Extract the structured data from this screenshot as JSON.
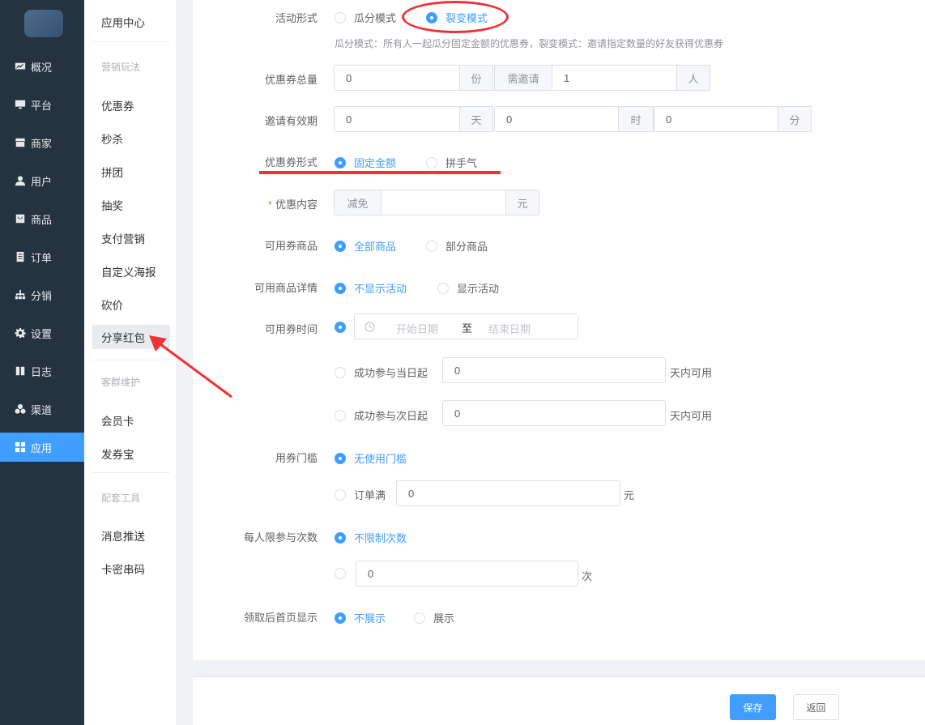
{
  "nav": {
    "items": [
      {
        "label": "概况",
        "icon": "dashboard-icon"
      },
      {
        "label": "平台",
        "icon": "monitor-icon"
      },
      {
        "label": "商家",
        "icon": "store-icon"
      },
      {
        "label": "用户",
        "icon": "user-icon"
      },
      {
        "label": "商品",
        "icon": "goods-icon"
      },
      {
        "label": "订单",
        "icon": "order-icon"
      },
      {
        "label": "分销",
        "icon": "distribution-icon"
      },
      {
        "label": "设置",
        "icon": "gear-icon"
      },
      {
        "label": "日志",
        "icon": "log-icon"
      },
      {
        "label": "渠道",
        "icon": "channel-icon"
      },
      {
        "label": "应用",
        "icon": "apps-icon"
      }
    ],
    "active": "应用"
  },
  "subnav": {
    "title": "应用中心",
    "group_marketing": "营销玩法",
    "items_marketing": [
      "优惠券",
      "秒杀",
      "拼团",
      "抽奖",
      "支付营销",
      "自定义海报",
      "砍价",
      "分享红包"
    ],
    "active": "分享红包",
    "group_customer": "客群维护",
    "items_customer": [
      "会员卡",
      "发券宝"
    ],
    "group_tools": "配套工具",
    "items_tools": [
      "消息推送",
      "卡密串码"
    ]
  },
  "form": {
    "activity_type": {
      "label": "活动形式",
      "options": [
        "瓜分模式",
        "裂变模式"
      ],
      "selected": "裂变模式",
      "hint": "瓜分模式：所有人一起瓜分固定金额的优惠券，裂变模式：邀请指定数量的好友获得优惠券"
    },
    "coupon_total": {
      "label": "优惠券总量",
      "value": "0",
      "unit": "份",
      "invite_label": "需邀请",
      "invite_value": "1",
      "invite_unit": "人"
    },
    "invite_validity": {
      "label": "邀请有效期",
      "day_value": "0",
      "day_unit": "天",
      "hour_value": "0",
      "hour_unit": "时",
      "minute_value": "0",
      "minute_unit": "分"
    },
    "coupon_form": {
      "label": "优惠券形式",
      "options": [
        "固定金额",
        "拼手气"
      ],
      "selected": "固定金额"
    },
    "discount_content": {
      "label": "优惠内容",
      "prefix": "减免",
      "value": "",
      "unit": "元"
    },
    "applicable_goods": {
      "label": "可用券商品",
      "options": [
        "全部商品",
        "部分商品"
      ],
      "selected": "全部商品"
    },
    "goods_detail": {
      "label": "可用商品详情",
      "options": [
        "不显示活动",
        "显示活动"
      ],
      "selected": "不显示活动"
    },
    "use_time": {
      "label": "可用券时间",
      "start_placeholder": "开始日期",
      "range_separator": "至",
      "end_placeholder": "结束日期",
      "option_same_day": {
        "prefix": "成功参与当日起",
        "value": "0",
        "suffix": "天内可用"
      },
      "option_next_day": {
        "prefix": "成功参与次日起",
        "value": "0",
        "suffix": "天内可用"
      }
    },
    "threshold": {
      "label": "用券门槛",
      "option_none": "无使用门槛",
      "option_order": {
        "prefix": "订单满",
        "value": "0",
        "suffix": "元"
      }
    },
    "limit": {
      "label": "每人限参与次数",
      "option_unlimited": "不限制次数",
      "custom_value": "0",
      "custom_suffix": "次"
    },
    "homepage_display": {
      "label": "领取后首页显示",
      "options": [
        "不展示",
        "展示"
      ],
      "selected": "不展示"
    }
  },
  "footer": {
    "save": "保存",
    "back": "返回"
  },
  "colors": {
    "primary": "#409eff",
    "sidebar": "#253240",
    "annotation": "#f0313a"
  }
}
